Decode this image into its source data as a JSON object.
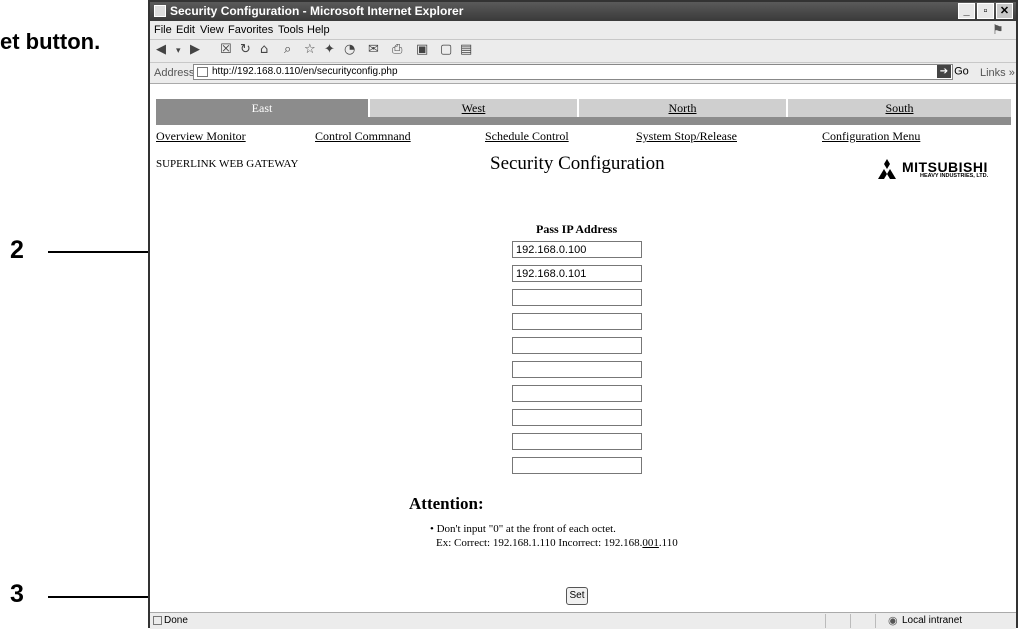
{
  "doc_heading": "et button.",
  "callouts": [
    {
      "number": "2"
    },
    {
      "number": "3"
    }
  ],
  "window": {
    "title": "Security Configuration - Microsoft Internet Explorer",
    "buttons": {
      "minimize": "_",
      "maximize": "▫",
      "close": "✕"
    }
  },
  "menu": [
    "File",
    "Edit",
    "View",
    "Favorites",
    "Tools",
    "Help"
  ],
  "address": {
    "label": "Address",
    "url": "http://192.168.0.110/en/securityconfig.php",
    "go": "Go",
    "links": "Links »"
  },
  "tabs": [
    {
      "label": "East",
      "active": true
    },
    {
      "label": "West",
      "active": false
    },
    {
      "label": "North",
      "active": false
    },
    {
      "label": "South",
      "active": false
    }
  ],
  "nav": [
    "Overview Monitor",
    "Control Commnand",
    "Schedule Control",
    "System Stop/Release",
    "Configuration Menu"
  ],
  "brand": "SUPERLINK WEB GATEWAY",
  "page_title": "Security Configuration",
  "logo": {
    "name": "MITSUBISHI",
    "sub": "HEAVY INDUSTRIES, LTD."
  },
  "pass_ip": {
    "label": "Pass IP Address",
    "values": [
      "192.168.0.100",
      "192.168.0.101",
      "",
      "",
      "",
      "",
      "",
      "",
      "",
      ""
    ]
  },
  "attention": {
    "title": "Attention:",
    "bullet": "Don't input \"0\" at the front of each octet.",
    "example_prefix": "Ex: Correct: 192.168.1.110 Incorrect: 192.168.",
    "example_bad": "001",
    "example_suffix": ".110"
  },
  "set_button": "Set",
  "status": {
    "text": "Done",
    "zone": "Local intranet"
  }
}
